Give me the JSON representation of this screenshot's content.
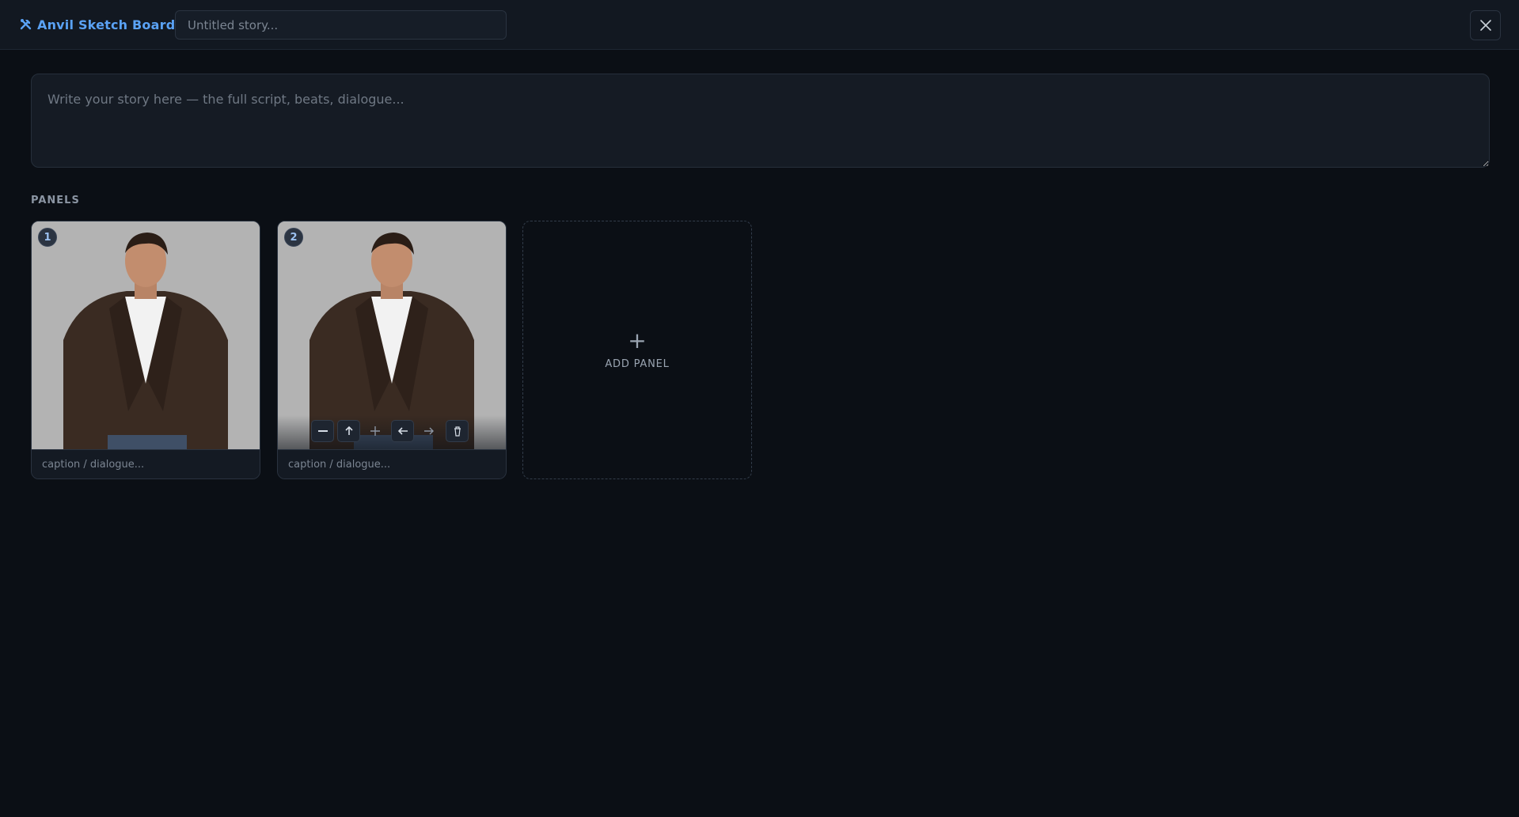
{
  "app": {
    "name": "Anvil Sketch Board",
    "accent": "#5aa2f5",
    "brand_icon": "hammer-wrench-icon"
  },
  "header": {
    "title_value": "",
    "title_placeholder": "Untitled story..."
  },
  "story": {
    "value": "",
    "placeholder": "Write your story here — the full script, beats, dialogue..."
  },
  "panels_section": {
    "label": "PANELS",
    "items": [
      {
        "number": "1",
        "caption_value": "",
        "caption_placeholder": "caption / dialogue..."
      },
      {
        "number": "2",
        "caption_value": "",
        "caption_placeholder": "caption / dialogue..."
      }
    ],
    "toolbar_icons": [
      "resize-icon",
      "arrow-up-icon",
      "move-icon",
      "arrow-left-icon",
      "arrow-right-icon",
      "trash-icon"
    ]
  },
  "add_panel": {
    "plus": "+",
    "label": "ADD PANEL"
  }
}
